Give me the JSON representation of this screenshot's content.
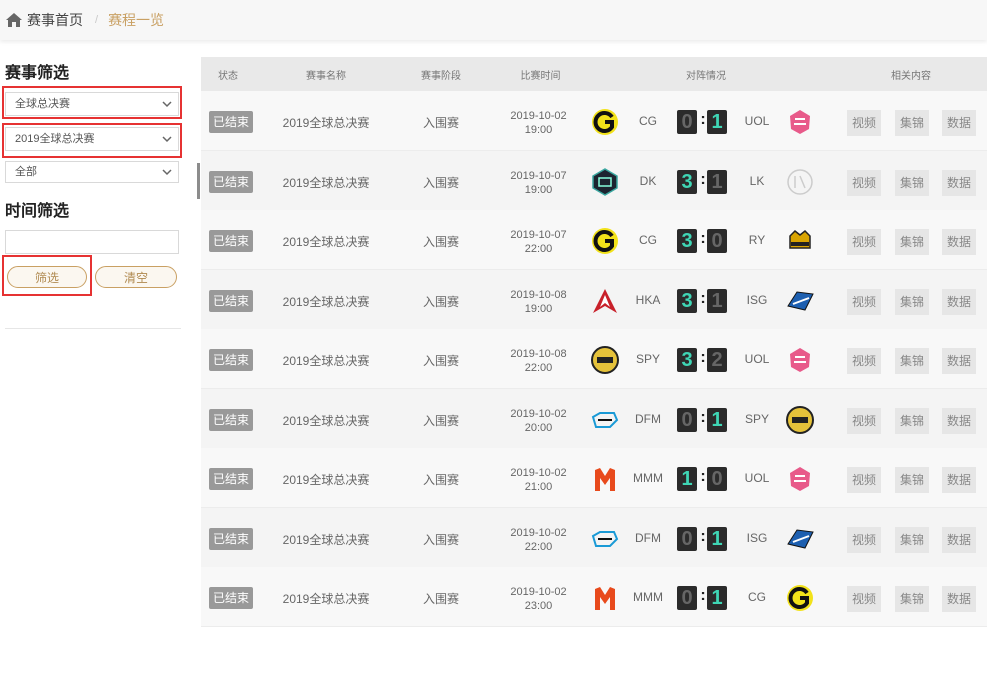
{
  "breadcrumb": {
    "home": "赛事首页",
    "current": "赛程一览"
  },
  "sidebar": {
    "event_filter_title": "赛事筛选",
    "select_event_type": "全球总决赛",
    "select_event": "2019全球总决赛",
    "select_stage": "全部",
    "time_filter_title": "时间筛选",
    "filter_button": "筛选",
    "clear_button": "清空"
  },
  "table": {
    "headers": [
      "状态",
      "赛事名称",
      "赛事阶段",
      "比赛时间",
      "对阵情况",
      "相关内容"
    ],
    "actions": [
      "视频",
      "集锦",
      "数据"
    ],
    "rows": [
      {
        "status": "已结束",
        "event": "2019全球总决赛",
        "stage": "入围赛",
        "date": "2019-10-02",
        "time": "19:00",
        "team1": "CG",
        "score1": "0",
        "score2": "1",
        "team2": "UOL",
        "logo1": "cg-logo-icon",
        "logo2": "uol-logo-icon"
      },
      {
        "status": "已结束",
        "event": "2019全球总决赛",
        "stage": "入围赛",
        "date": "2019-10-07",
        "time": "19:00",
        "team1": "DK",
        "score1": "3",
        "score2": "1",
        "team2": "LK",
        "logo1": "dk-logo-icon",
        "logo2": "lk-logo-icon"
      },
      {
        "status": "已结束",
        "event": "2019全球总决赛",
        "stage": "入围赛",
        "date": "2019-10-07",
        "time": "22:00",
        "team1": "CG",
        "score1": "3",
        "score2": "0",
        "team2": "RY",
        "logo1": "cg-logo-icon",
        "logo2": "ry-logo-icon"
      },
      {
        "status": "已结束",
        "event": "2019全球总决赛",
        "stage": "入围赛",
        "date": "2019-10-08",
        "time": "19:00",
        "team1": "HKA",
        "score1": "3",
        "score2": "1",
        "team2": "ISG",
        "logo1": "hka-logo-icon",
        "logo2": "isg-logo-icon"
      },
      {
        "status": "已结束",
        "event": "2019全球总决赛",
        "stage": "入围赛",
        "date": "2019-10-08",
        "time": "22:00",
        "team1": "SPY",
        "score1": "3",
        "score2": "2",
        "team2": "UOL",
        "logo1": "spy-logo-icon",
        "logo2": "uol-logo-icon"
      },
      {
        "status": "已结束",
        "event": "2019全球总决赛",
        "stage": "入围赛",
        "date": "2019-10-02",
        "time": "20:00",
        "team1": "DFM",
        "score1": "0",
        "score2": "1",
        "team2": "SPY",
        "logo1": "dfm-logo-icon",
        "logo2": "spy-logo-icon"
      },
      {
        "status": "已结束",
        "event": "2019全球总决赛",
        "stage": "入围赛",
        "date": "2019-10-02",
        "time": "21:00",
        "team1": "MMM",
        "score1": "1",
        "score2": "0",
        "team2": "UOL",
        "logo1": "mmm-logo-icon",
        "logo2": "uol-logo-icon"
      },
      {
        "status": "已结束",
        "event": "2019全球总决赛",
        "stage": "入围赛",
        "date": "2019-10-02",
        "time": "22:00",
        "team1": "DFM",
        "score1": "0",
        "score2": "1",
        "team2": "ISG",
        "logo1": "dfm-logo-icon",
        "logo2": "isg-logo-icon"
      },
      {
        "status": "已结束",
        "event": "2019全球总决赛",
        "stage": "入围赛",
        "date": "2019-10-02",
        "time": "23:00",
        "team1": "MMM",
        "score1": "0",
        "score2": "1",
        "team2": "CG",
        "logo1": "mmm-logo-icon",
        "logo2": "cg-logo-icon"
      }
    ]
  },
  "colors": {
    "accent": "#c9a063",
    "win_score": "#3fd6b5",
    "highlight_frame": "#e63232"
  }
}
